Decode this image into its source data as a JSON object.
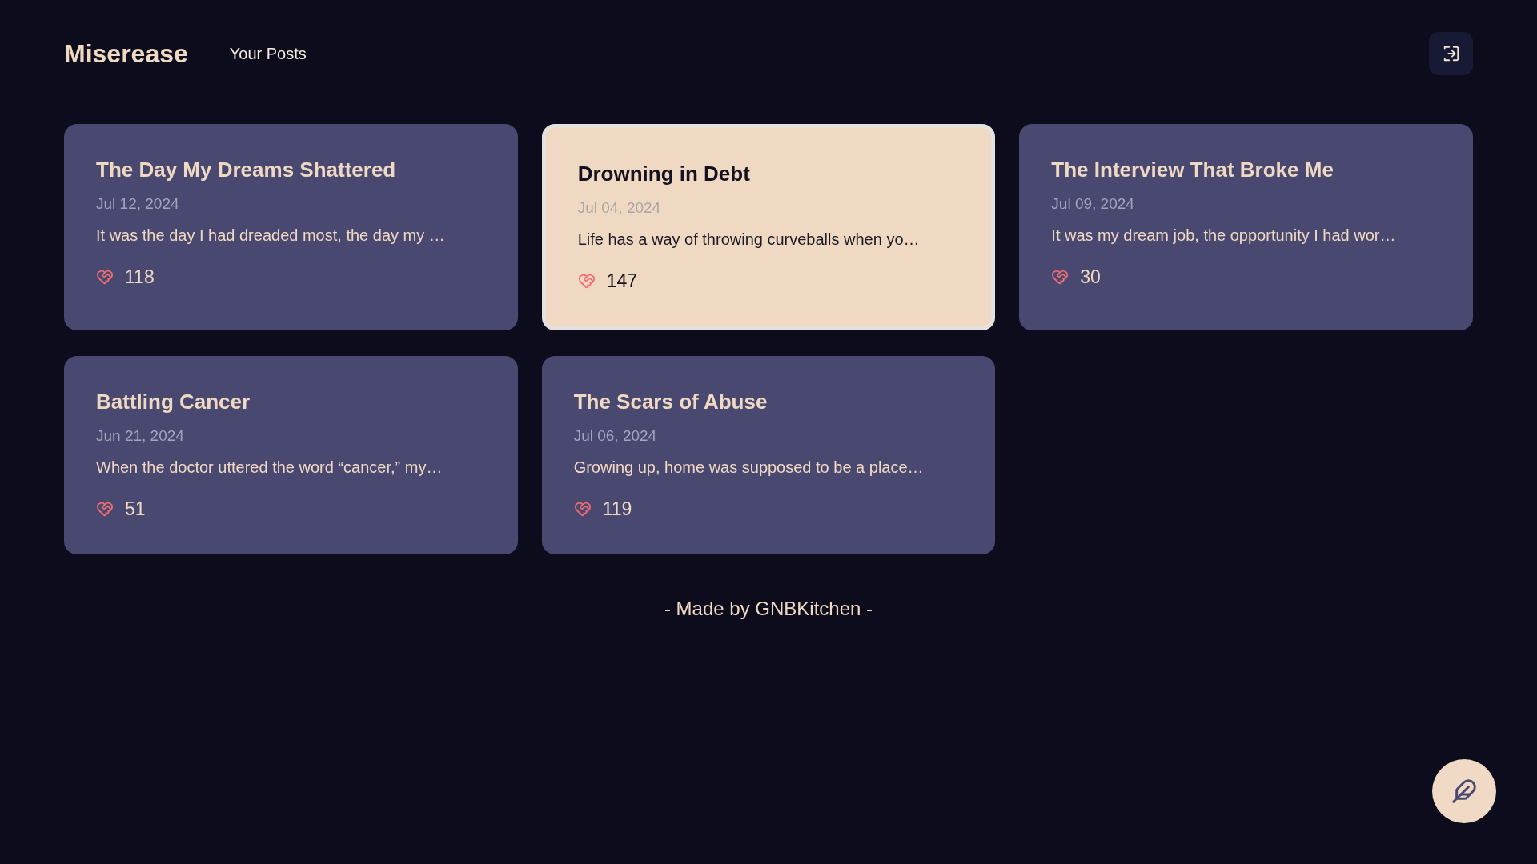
{
  "header": {
    "logo": "Miserease",
    "nav": [
      {
        "label": "Your Posts"
      }
    ]
  },
  "posts": [
    {
      "title": "The Day My Dreams Shattered",
      "date": "Jul 12, 2024",
      "excerpt": "It was the day I had dreaded most, the day my …",
      "likes": "118",
      "selected": false
    },
    {
      "title": "Drowning in Debt",
      "date": "Jul 04, 2024",
      "excerpt": "Life has a way of throwing curveballs when yo…",
      "likes": "147",
      "selected": true
    },
    {
      "title": "The Interview That Broke Me",
      "date": "Jul 09, 2024",
      "excerpt": "It was my dream job, the opportunity I had wor…",
      "likes": "30",
      "selected": false
    },
    {
      "title": "Battling Cancer",
      "date": "Jun 21, 2024",
      "excerpt": "When the doctor uttered the word “cancer,” my…",
      "likes": "51",
      "selected": false
    },
    {
      "title": "The Scars of Abuse",
      "date": "Jul 06, 2024",
      "excerpt": "Growing up, home was supposed to be a place…",
      "likes": "119",
      "selected": false
    }
  ],
  "footer": "- Made by GNBKitchen -"
}
